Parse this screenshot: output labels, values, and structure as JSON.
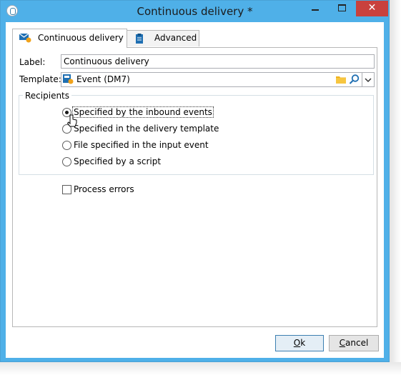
{
  "window": {
    "title": "Continuous delivery *",
    "close_glyph": "✕"
  },
  "tabs": [
    {
      "label": "Continuous delivery",
      "icon": "envelope-icon"
    },
    {
      "label": "Advanced",
      "icon": "clipboard-icon"
    }
  ],
  "form": {
    "label_caption": "Label:",
    "label_value": "Continuous delivery",
    "template_caption": "Template:",
    "template_value": "Event (DM7)"
  },
  "recipients": {
    "title": "Recipients",
    "options": [
      {
        "label": "Specified by the inbound events",
        "selected": true
      },
      {
        "label": "Specified in the delivery template",
        "selected": false
      },
      {
        "label": "File specified in the input event",
        "selected": false
      },
      {
        "label": "Specified by a script",
        "selected": false
      }
    ]
  },
  "process_errors": {
    "label": "Process errors",
    "checked": false
  },
  "buttons": {
    "ok_label": "Ok",
    "cancel_label": "Cancel"
  },
  "colors": {
    "title_bar": "#4fb0e8",
    "close_button": "#c9413d"
  }
}
